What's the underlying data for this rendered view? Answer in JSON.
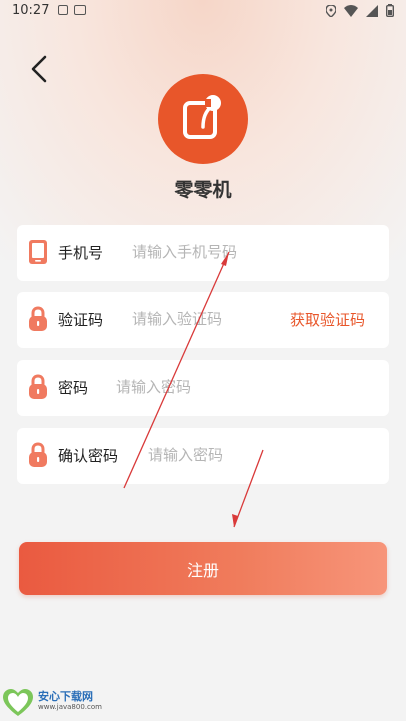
{
  "status_bar": {
    "time": "10:27",
    "icons": [
      "notification-a-icon",
      "notification-image-icon",
      "location-icon",
      "wifi-icon",
      "signal-icon",
      "battery-icon"
    ]
  },
  "header": {
    "app_name": "零零机"
  },
  "form": {
    "phone": {
      "label": "手机号",
      "placeholder": "请输入手机号码",
      "value": ""
    },
    "code": {
      "label": "验证码",
      "placeholder": "请输入验证码",
      "value": "",
      "get_code_label": "获取验证码"
    },
    "password": {
      "label": "密码",
      "placeholder": "请输入密码",
      "value": ""
    },
    "confirm_password": {
      "label": "确认密码",
      "placeholder": "请输入密码",
      "value": ""
    }
  },
  "actions": {
    "register_label": "注册"
  },
  "watermark": {
    "brand": "安心下载网",
    "url": "www.java800.com"
  },
  "colors": {
    "accent": "#e8562a",
    "button_start": "#ea5a40",
    "button_end": "#f7957a"
  }
}
